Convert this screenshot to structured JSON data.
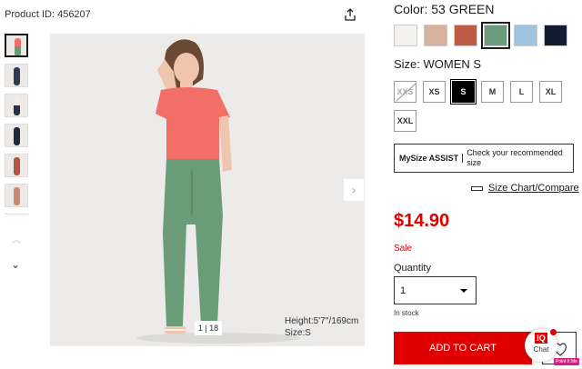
{
  "product": {
    "id_text": "Product ID: 456207"
  },
  "gallery": {
    "counter": "1 | 18",
    "model_height": "Height:5'7''/169cm",
    "model_size": "Size:S",
    "thumbs": [
      {
        "top": "#f26f68",
        "bottom": "#6b9c78"
      },
      {
        "top": "#2f3c51",
        "bottom": "#2f3c51"
      },
      {
        "top": "#f1ede8",
        "bottom": "#27324a"
      },
      {
        "top": "#1f2a3f",
        "bottom": "#1f2a3f"
      },
      {
        "top": "#b0563f",
        "bottom": "#b0563f"
      },
      {
        "top": "#c98a73",
        "bottom": "#c98a73"
      }
    ]
  },
  "color": {
    "label": "Color:  53 GREEN",
    "swatches": [
      "#f4f2ee",
      "#d6b29c",
      "#bf5a43",
      "#6c9b7c",
      "#9fc3de",
      "#121d33"
    ],
    "selected_index": 3
  },
  "size": {
    "label": "Size:  WOMEN S",
    "options": [
      "XXS",
      "XS",
      "S",
      "M",
      "L",
      "XL",
      "XXL"
    ],
    "selected": "S",
    "unavailable": [
      "XXS"
    ]
  },
  "mysize": {
    "brand": "MySize ASSIST",
    "text": "Check your recommended size"
  },
  "size_chart": "Size Chart/Compare",
  "price": "$14.90",
  "sale": "Sale",
  "quantity": {
    "label": "Quantity",
    "value": "1"
  },
  "stock": "In stock",
  "add_to_cart": "ADD TO CART",
  "chat": {
    "logo": "IQ",
    "label": "Chat"
  },
  "pointit": "Point It Me"
}
